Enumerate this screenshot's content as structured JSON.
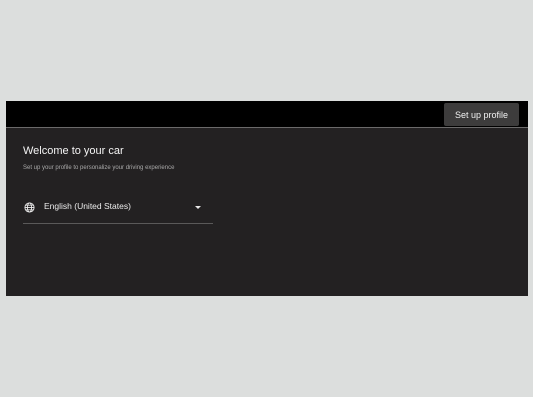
{
  "header": {
    "setup_button_label": "Set up profile"
  },
  "welcome": {
    "title": "Welcome to your car",
    "subtitle": "Set up your profile to personalize your driving experience"
  },
  "language": {
    "icon": "globe-icon",
    "selected": "English (United States)",
    "dropdown_icon": "caret-down-icon"
  },
  "colors": {
    "page_background": "#dcdedd",
    "screen_background": "#232122",
    "topbar_background": "#000000",
    "button_background": "#3d3c3c"
  }
}
